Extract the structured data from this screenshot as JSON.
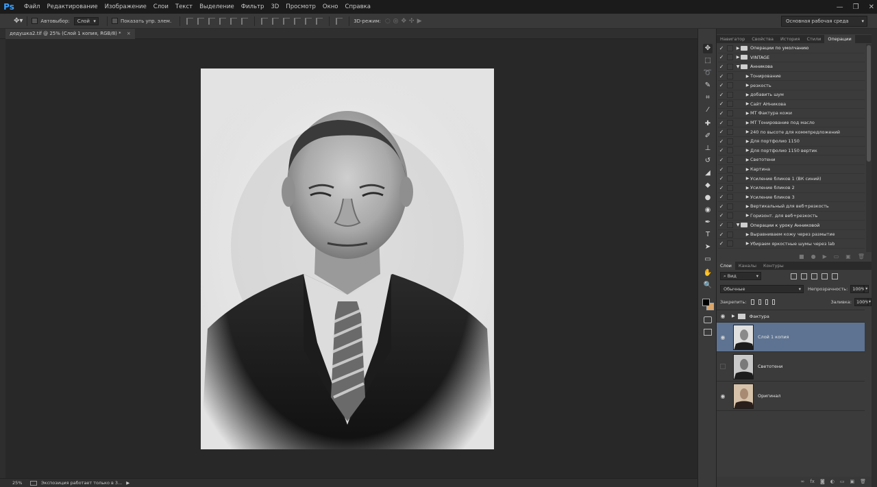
{
  "app": {
    "logo": "Ps",
    "menu": [
      "Файл",
      "Редактирование",
      "Изображение",
      "Слои",
      "Текст",
      "Выделение",
      "Фильтр",
      "3D",
      "Просмотр",
      "Окно",
      "Справка"
    ],
    "window_controls": [
      "—",
      "❐",
      "✕"
    ]
  },
  "options_bar": {
    "autoselect_label": "Автовыбор:",
    "autoselect_value": "Слой",
    "show_controls_label": "Показать упр. элем.",
    "mode_3d_label": "3D-режим:",
    "workspace": "Основная рабочая среда"
  },
  "document": {
    "tab_title": "дедушка2.tif @ 25% (Слой 1 копия, RGB/8) *",
    "close": "×"
  },
  "status": {
    "zoom": "25%",
    "info": "Экспозиция работает только в 3...",
    "arrow": "▶"
  },
  "actions_panel": {
    "tabs": [
      "Навигатор",
      "Свойства",
      "История",
      "Стили",
      "Операции"
    ],
    "active_tab": "Операции",
    "items": [
      {
        "label": "Операции по умолчанию",
        "type": "set",
        "expanded": false
      },
      {
        "label": "VINTAGE",
        "type": "set",
        "expanded": false
      },
      {
        "label": "Анникова",
        "type": "set",
        "expanded": true
      },
      {
        "label": "Тонирование",
        "type": "action"
      },
      {
        "label": "резкость",
        "type": "action"
      },
      {
        "label": "добавить шум",
        "type": "action"
      },
      {
        "label": "Сайт АНникова",
        "type": "action"
      },
      {
        "label": "МТ Фактура кожи",
        "type": "action"
      },
      {
        "label": "МТ Тонирование под масло",
        "type": "action"
      },
      {
        "label": "240 по высоте для коммпредложений",
        "type": "action"
      },
      {
        "label": "Для портфолио 1150",
        "type": "action"
      },
      {
        "label": "Для портфолио 1150 вертик",
        "type": "action"
      },
      {
        "label": "Светотени",
        "type": "action"
      },
      {
        "label": "Картина",
        "type": "action"
      },
      {
        "label": "Усиление бликов 1 (ВК синий)",
        "type": "action"
      },
      {
        "label": "Усиление бликов 2",
        "type": "action"
      },
      {
        "label": "Усиление бликов 3",
        "type": "action"
      },
      {
        "label": "Вертикальный для веб+резкость",
        "type": "action"
      },
      {
        "label": "Горизонт. для веб+резкость",
        "type": "action"
      },
      {
        "label": "Операции к уроку Анниковой",
        "type": "set",
        "expanded": true
      },
      {
        "label": "Выравниваем кожу через размытие",
        "type": "action"
      },
      {
        "label": "Убираем яркостные шумы через lab",
        "type": "action"
      }
    ],
    "footer_icons": [
      "■",
      "●",
      "▶",
      "▭",
      "▣",
      "🗑"
    ]
  },
  "layers_panel": {
    "tabs": [
      "Слои",
      "Каналы",
      "Контуры"
    ],
    "active_tab": "Слои",
    "filter_value": "Вид",
    "blend_mode": "Обычные",
    "opacity_label": "Непрозрачность:",
    "opacity_value": "100%",
    "lock_label": "Закрепить:",
    "fill_label": "Заливка:",
    "fill_value": "100%",
    "layers": [
      {
        "name": "Фактура",
        "type": "group",
        "visible": true,
        "selected": false
      },
      {
        "name": "Слой 1 копия",
        "type": "layer",
        "visible": true,
        "selected": true
      },
      {
        "name": "Светотени",
        "type": "layer",
        "visible": false,
        "selected": false
      },
      {
        "name": "Оригинал",
        "type": "layer",
        "visible": true,
        "selected": false
      }
    ],
    "footer_icons": [
      "∞",
      "fx",
      "◙",
      "◐",
      "▭",
      "▣",
      "🗑"
    ]
  },
  "tools": [
    {
      "name": "move-tool",
      "glyph": "✥"
    },
    {
      "name": "marquee-tool",
      "glyph": "⬚"
    },
    {
      "name": "lasso-tool",
      "glyph": "➰"
    },
    {
      "name": "quick-select-tool",
      "glyph": "✎"
    },
    {
      "name": "crop-tool",
      "glyph": "⌗"
    },
    {
      "name": "eyedropper-tool",
      "glyph": "⁄"
    },
    {
      "name": "healing-tool",
      "glyph": "✚"
    },
    {
      "name": "brush-tool",
      "glyph": "✐"
    },
    {
      "name": "stamp-tool",
      "glyph": "⊥"
    },
    {
      "name": "history-brush-tool",
      "glyph": "↺"
    },
    {
      "name": "eraser-tool",
      "glyph": "◢"
    },
    {
      "name": "paint-bucket-tool",
      "glyph": "◆"
    },
    {
      "name": "blur-tool",
      "glyph": "●"
    },
    {
      "name": "dodge-tool",
      "glyph": "◉"
    },
    {
      "name": "pen-tool",
      "glyph": "✒"
    },
    {
      "name": "type-tool",
      "glyph": "T"
    },
    {
      "name": "path-select-tool",
      "glyph": "➤"
    },
    {
      "name": "shape-tool",
      "glyph": "▭"
    },
    {
      "name": "hand-tool",
      "glyph": "✋"
    },
    {
      "name": "zoom-tool",
      "glyph": "🔍"
    }
  ],
  "colors": {
    "foreground": "#000000",
    "background": "#d9a66b",
    "selection": "#5d7391",
    "ps_logo": "#3aa0ff"
  }
}
